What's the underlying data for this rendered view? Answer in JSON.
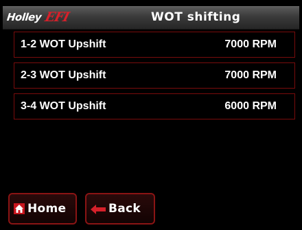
{
  "header": {
    "brand_holley": "Holley",
    "brand_efi": "EFI",
    "title": "WOT shifting"
  },
  "rows": [
    {
      "label": "1-2 WOT Upshift",
      "value": "7000 RPM"
    },
    {
      "label": "2-3 WOT Upshift",
      "value": "7000 RPM"
    },
    {
      "label": "3-4 WOT Upshift",
      "value": "6000 RPM"
    }
  ],
  "buttons": {
    "home_label": "Home",
    "back_label": "Back"
  },
  "icons": {
    "home": "home-icon",
    "back": "arrow-left-icon"
  },
  "colors": {
    "accent": "#d6202a",
    "row_border": "#7a0c0c",
    "button_border": "#8a1414"
  }
}
